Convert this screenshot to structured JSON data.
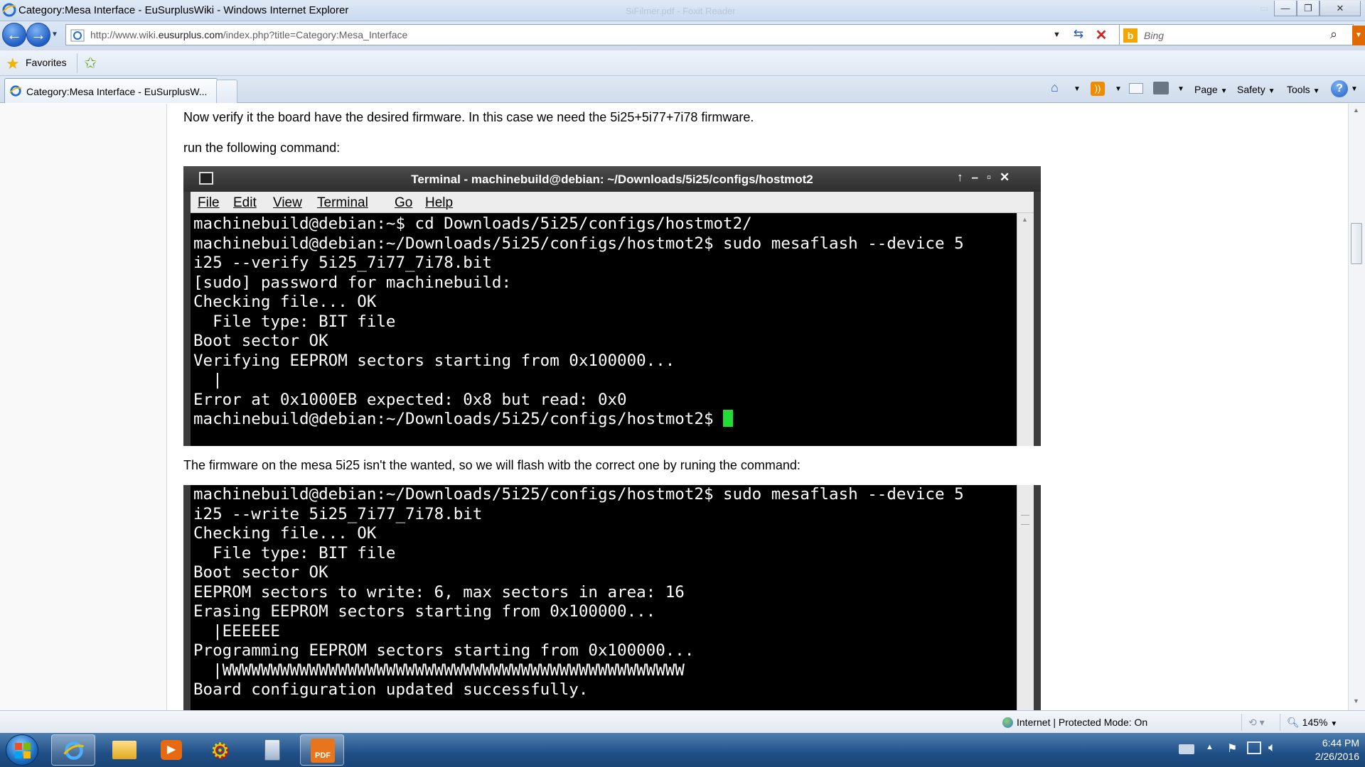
{
  "window": {
    "title": "Category:Mesa Interface - EuSurplusWiki - Windows Internet Explorer",
    "background_title": "SiFilmer.pdf - Foxit Reader"
  },
  "address_bar": {
    "url_prefix": "http://www.wiki.",
    "url_domain": "eusurplus.com",
    "url_suffix": "/index.php?title=Category:Mesa_Interface"
  },
  "search": {
    "placeholder": "Bing"
  },
  "favorites": {
    "label": "Favorites"
  },
  "tab": {
    "label": "Category:Mesa Interface - EuSurplusW..."
  },
  "command_bar": {
    "page": "Page",
    "safety": "Safety",
    "tools": "Tools"
  },
  "content": {
    "para1": "Now verify it the board have the desired firmware. In this case we need the 5i25+5i77+7i78 firmware.",
    "para2": "run the following command:",
    "para3": "The firmware on the mesa 5i25 isn't the wanted, so we will flash witb the correct one by runing the command:"
  },
  "terminal1": {
    "title": "Terminal - machinebuild@debian: ~/Downloads/5i25/configs/hostmot2",
    "menu": [
      "File",
      "Edit",
      "View",
      "Terminal",
      "Go",
      "Help"
    ],
    "lines": [
      "machinebuild@debian:~$ cd Downloads/5i25/configs/hostmot2/",
      "machinebuild@debian:~/Downloads/5i25/configs/hostmot2$ sudo mesaflash --device 5",
      "i25 --verify 5i25_7i77_7i78.bit",
      "[sudo] password for machinebuild:",
      "Checking file... OK",
      "  File type: BIT file",
      "Boot sector OK",
      "Verifying EEPROM sectors starting from 0x100000...",
      "  |",
      "Error at 0x1000EB expected: 0x8 but read: 0x0"
    ],
    "prompt": "machinebuild@debian:~/Downloads/5i25/configs/hostmot2$ "
  },
  "terminal2": {
    "lines": [
      "machinebuild@debian:~/Downloads/5i25/configs/hostmot2$ sudo mesaflash --device 5",
      "i25 --write 5i25_7i77_7i78.bit",
      "Checking file... OK",
      "  File type: BIT file",
      "Boot sector OK",
      "EEPROM sectors to write: 6, max sectors in area: 16",
      "Erasing EEPROM sectors starting from 0x100000...",
      "  |EEEEEE",
      "Programming EEPROM sectors starting from 0x100000...",
      "  |WWWWWWWWWWWWWWWWWWWWWWWWWWWWWWWWWWWWWWWWWWWWWWWW",
      "Board configuration updated successfully."
    ]
  },
  "status_bar": {
    "zone": "Internet | Protected Mode: On",
    "zoom": "145%"
  },
  "taskbar": {
    "time": "6:44 PM",
    "date": "2/26/2016"
  },
  "colors": {
    "ie_blue": "#1f5fc4",
    "terminal_bg": "#000000",
    "cursor": "#22dd33",
    "taskbar": "#1f4f86"
  }
}
